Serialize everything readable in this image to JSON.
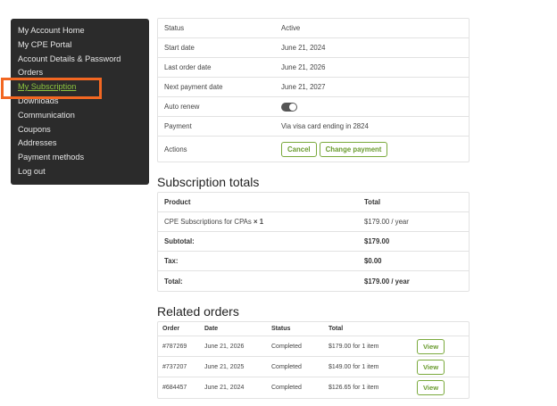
{
  "sidebar": {
    "items": [
      {
        "label": "My Account Home"
      },
      {
        "label": "My CPE Portal"
      },
      {
        "label": "Account Details & Password"
      },
      {
        "label": "Orders"
      },
      {
        "label": "My Subscription"
      },
      {
        "label": "Downloads"
      },
      {
        "label": "Communication"
      },
      {
        "label": "Coupons"
      },
      {
        "label": "Addresses"
      },
      {
        "label": "Payment methods"
      },
      {
        "label": "Log out"
      }
    ],
    "active_color": "#8dc63f",
    "highlight_color": "#f26722"
  },
  "details": {
    "status_label": "Status",
    "status_value": "Active",
    "start_label": "Start date",
    "start_value": "June 21, 2024",
    "last_order_label": "Last order date",
    "last_order_value": "June 21, 2026",
    "next_payment_label": "Next payment date",
    "next_payment_value": "June 21, 2027",
    "auto_renew_label": "Auto renew",
    "auto_renew_on": true,
    "payment_label": "Payment",
    "payment_value": "Via visa card ending in 2824",
    "actions_label": "Actions",
    "cancel_label": "Cancel",
    "change_payment_label": "Change payment"
  },
  "totals": {
    "title": "Subscription totals",
    "header_product": "Product",
    "header_total": "Total",
    "item_name": "CPE Subscriptions for CPAs",
    "item_qty": "× 1",
    "item_total": "$179.00 / year",
    "subtotal_label": "Subtotal:",
    "subtotal_value": "$179.00",
    "tax_label": "Tax:",
    "tax_value": "$0.00",
    "total_label": "Total:",
    "total_value": "$179.00 / year"
  },
  "orders": {
    "title": "Related orders",
    "headers": {
      "order": "Order",
      "date": "Date",
      "status": "Status",
      "total": "Total"
    },
    "view_label": "View",
    "rows": [
      {
        "order": "#787269",
        "date": "June 21, 2026",
        "status": "Completed",
        "total": "$179.00 for 1 item"
      },
      {
        "order": "#737207",
        "date": "June 21, 2025",
        "status": "Completed",
        "total": "$149.00 for 1 item"
      },
      {
        "order": "#684457",
        "date": "June 21, 2024",
        "status": "Completed",
        "total": "$126.65 for 1 item"
      }
    ]
  },
  "colors": {
    "accent": "#6a9b2f",
    "sidebar_bg": "#2b2b2b"
  }
}
